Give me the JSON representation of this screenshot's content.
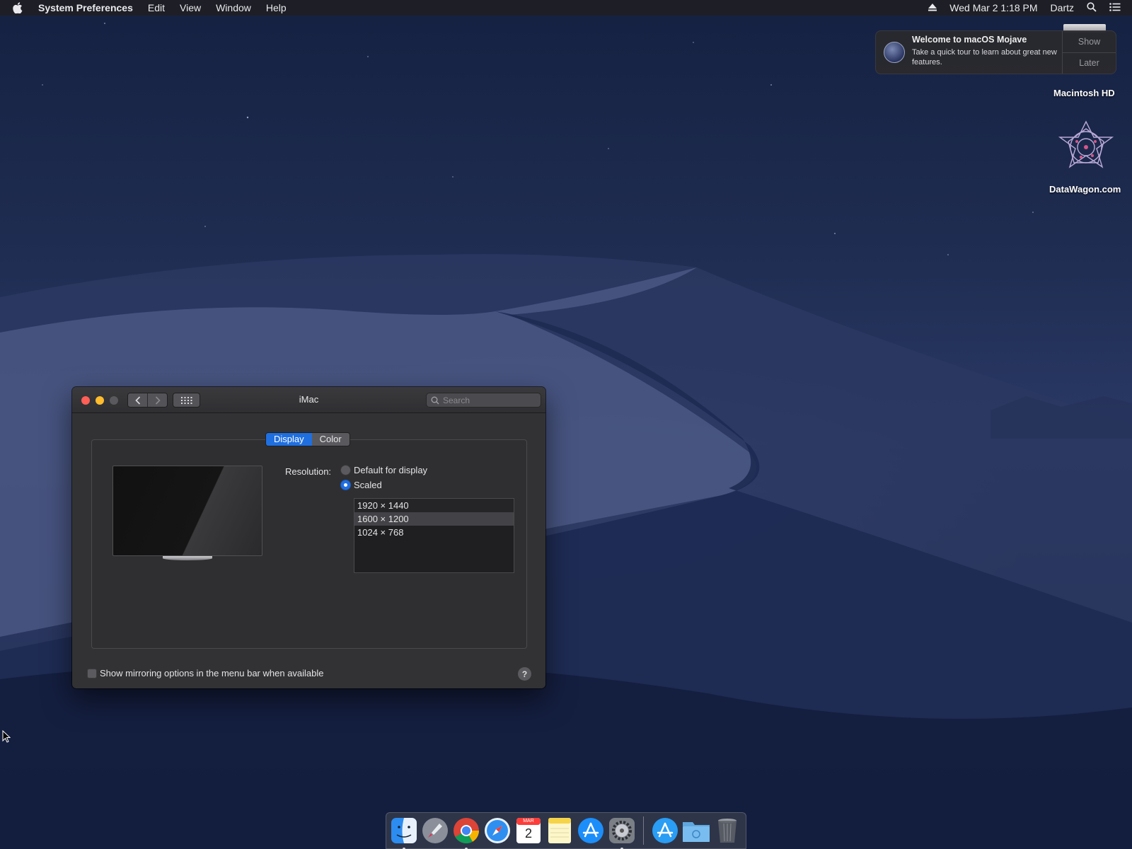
{
  "menubar": {
    "app_name": "System Preferences",
    "items": [
      "Edit",
      "View",
      "Window",
      "Help"
    ],
    "clock": "Wed Mar 2  1:18 PM",
    "user": "Dartz"
  },
  "notification": {
    "title": "Welcome to macOS Mojave",
    "text": "Take a quick tour to learn about great new features.",
    "show_label": "Show",
    "later_label": "Later"
  },
  "desktop": {
    "hd_label": "Macintosh HD",
    "datawagon_label": "DataWagon.com"
  },
  "window": {
    "title": "iMac",
    "search_placeholder": "Search",
    "tabs": {
      "display": "Display",
      "color": "Color"
    },
    "resolution_label": "Resolution:",
    "option_default": "Default for display",
    "option_scaled": "Scaled",
    "resolutions": [
      "1920 × 1440",
      "1600 × 1200",
      "1024 × 768"
    ],
    "selected_resolution": "1600 × 1200",
    "mirroring_label": "Show mirroring options in the menu bar when available",
    "help_label": "?"
  },
  "dock": {
    "calendar_month": "MAR",
    "calendar_day": "2",
    "items": [
      "finder-icon",
      "launchpad-icon",
      "chrome-icon",
      "safari-icon",
      "calendar-icon",
      "notes-icon",
      "app-store-icon",
      "system-preferences-icon",
      "app-store-downloads-icon",
      "downloads-folder-icon",
      "trash-icon"
    ]
  },
  "colors": {
    "accent": "#1f6fe0",
    "close": "#ff5f57",
    "minimize": "#febc2e"
  }
}
